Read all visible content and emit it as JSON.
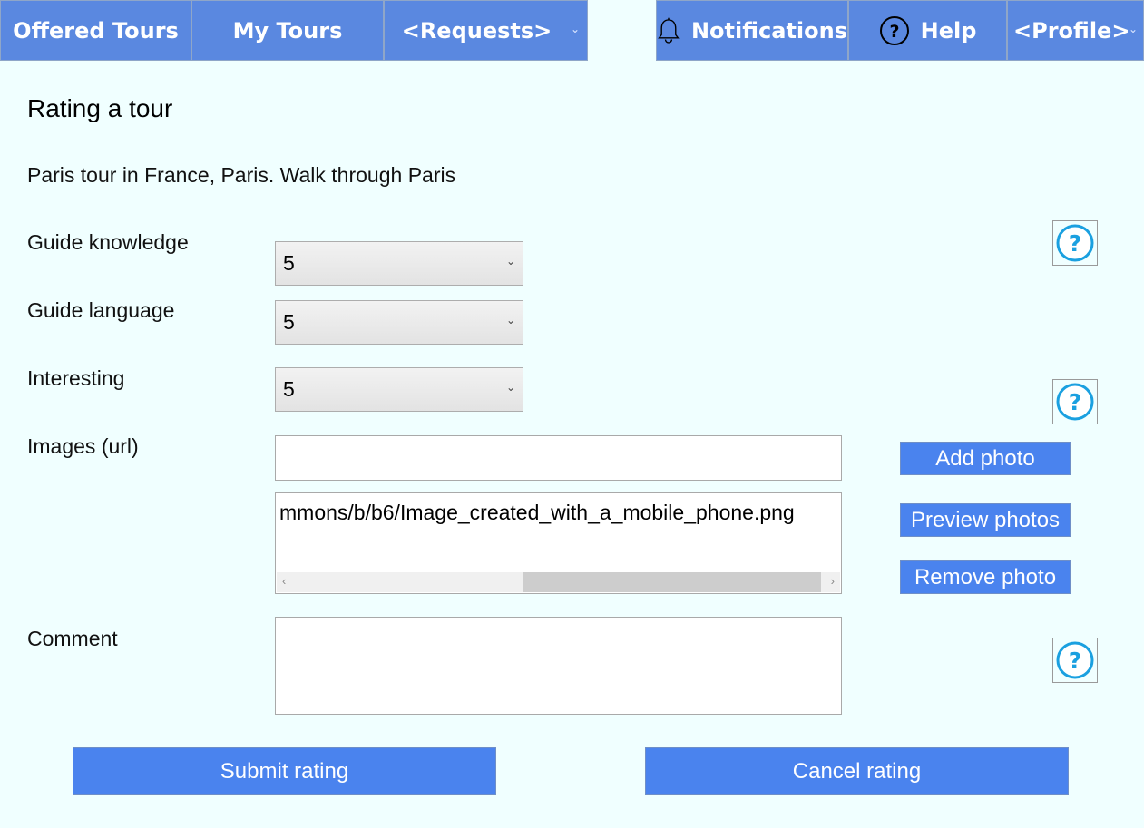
{
  "nav": {
    "offered_tours": "Offered Tours",
    "my_tours": "My Tours",
    "requests": "<Requests>",
    "notifications": "Notifications",
    "help": "Help",
    "profile": "<Profile>"
  },
  "form": {
    "title": "Rating a tour",
    "tour_description": "Paris tour in France, Paris. Walk through Paris",
    "guide_knowledge_label": "Guide knowledge",
    "guide_knowledge_value": "5",
    "guide_language_label": "Guide language",
    "guide_language_value": "5",
    "interesting_label": "Interesting",
    "interesting_value": "5",
    "images_label": "Images (url)",
    "image_url_value": "",
    "image_list": [
      "mmons/b/b6/Image_created_with_a_mobile_phone.png"
    ],
    "comment_label": "Comment",
    "comment_value": ""
  },
  "buttons": {
    "add_photo": "Add photo",
    "preview_photos": "Preview photos",
    "remove_photo": "Remove photo",
    "submit": "Submit rating",
    "cancel": "Cancel rating"
  },
  "icons": {
    "nav_bell": "bell-icon",
    "nav_help": "question-circle-icon",
    "help_buttons": "question-circle-icon",
    "dropdown": "chevron-down-icon"
  },
  "colors": {
    "background": "#f0ffff",
    "nav": "#5a88e0",
    "button": "#4a83ee",
    "help_icon": "#1aa0e0"
  }
}
